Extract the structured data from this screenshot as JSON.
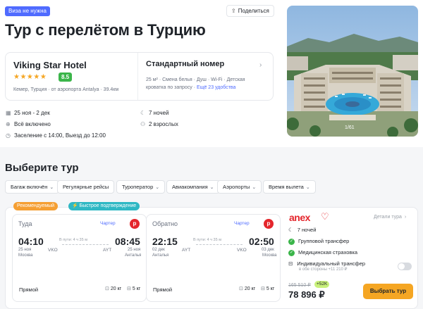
{
  "header": {
    "visa_badge": "Виза не нужна",
    "share_label": "Поделиться",
    "title": "Тур с перелётом в Турцию"
  },
  "hotel": {
    "name": "Viking Star Hotel",
    "stars": "★★★★★",
    "rating": "8.5",
    "location": "Кемер, Турция · от аэропорта Antalya · 39.4км"
  },
  "room": {
    "title": "Стандартный номер",
    "description": "25 м² · Смена белья · Душ · Wi-Fi · Детская кроватка по запросу ·",
    "more_link": "Ещё 23 удобства"
  },
  "trip_info": {
    "dates": "25 ноя - 2 дек",
    "meals": "Всё включено",
    "checkin": "Заселение с 14:00, Выезд до 12:00",
    "nights": "7 ночей",
    "guests": "2 взрослых"
  },
  "photo": {
    "counter": "1/61"
  },
  "choose": {
    "title": "Выберите тур",
    "filters": [
      "Багаж включён",
      "Регулярные рейсы",
      "Туроператор",
      "Авиакомпания",
      "Аэропорты",
      "Время вылета"
    ]
  },
  "tags": {
    "recommended": "Рекомендуемый",
    "fast_confirm": "⚡ Быстрое подтверждение"
  },
  "outbound": {
    "label": "Туда",
    "charter": "Чартер",
    "airline_icon": "pegasus-icon",
    "dep_time": "04:10",
    "dep_date": "25 ноя",
    "dep_city": "Москва",
    "duration": "В пути: 4 ч 35 м",
    "dep_code": "VKO",
    "arr_code": "AYT",
    "arr_time": "08:45",
    "arr_date": "25 ноя",
    "arr_city": "Анталья",
    "type": "Прямой",
    "bag": "20 кг",
    "hand": "5 кг"
  },
  "return": {
    "label": "Обратно",
    "charter": "Чартер",
    "airline_icon": "pegasus-icon",
    "dep_time": "22:15",
    "dep_date": "02 дек",
    "dep_city": "Анталья",
    "duration": "В пути: 4 ч 35 м",
    "dep_code": "AYT",
    "arr_code": "VKO",
    "arr_time": "02:50",
    "arr_date": "03 дек",
    "arr_city": "Москва",
    "type": "Прямой",
    "bag": "20 кг",
    "hand": "5 кг"
  },
  "offer": {
    "operator": "anex",
    "details_label": "Детали тура",
    "nights": "7 ночей",
    "group_transfer": "Групповой трансфер",
    "insurance": "Медицинская страховка",
    "individual_transfer": "Индивидуальный трансфер",
    "individual_transfer_sub": "в обе стороны +11 210 ₽",
    "old_price": "165 510 ₽",
    "cashback": "+52K",
    "price": "78 896 ₽",
    "book_label": "Выбрать тур"
  },
  "colors": {
    "accent": "#4f6bff",
    "cta": "#f5a623",
    "success": "#3bb54a",
    "brand_red": "#e4262c"
  }
}
